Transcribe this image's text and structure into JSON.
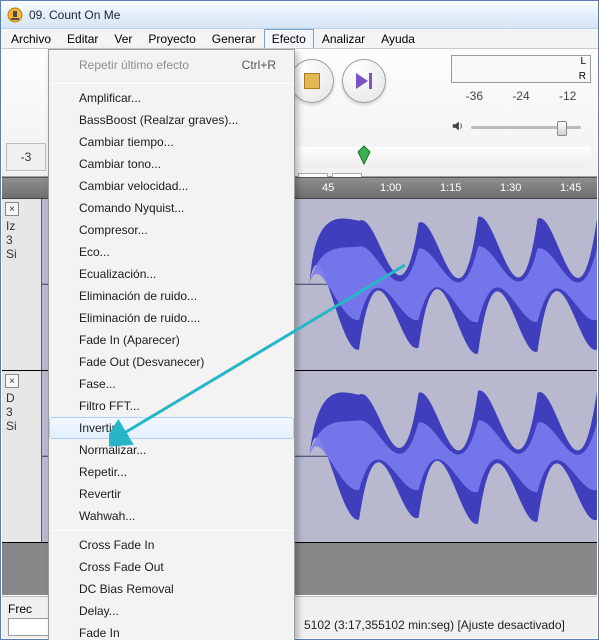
{
  "window": {
    "title": "09. Count On Me"
  },
  "menubar": {
    "items": [
      {
        "label": "Archivo"
      },
      {
        "label": "Editar"
      },
      {
        "label": "Ver"
      },
      {
        "label": "Proyecto"
      },
      {
        "label": "Generar"
      },
      {
        "label": "Efecto"
      },
      {
        "label": "Analizar"
      },
      {
        "label": "Ayuda"
      }
    ],
    "open_index": 5
  },
  "effect_menu": {
    "top": {
      "label": "Repetir último efecto",
      "accel": "Ctrl+R",
      "disabled": true
    },
    "group1": [
      "Amplificar...",
      "BassBoost (Realzar graves)...",
      "Cambiar tiempo...",
      "Cambiar tono...",
      "Cambiar velocidad...",
      "Comando Nyquist...",
      "Compresor...",
      "Eco...",
      "Ecualización...",
      "Eliminación de ruido...",
      "Eliminación de ruido....",
      "Fade In (Aparecer)",
      "Fade Out (Desvanecer)",
      "Fase...",
      "Filtro FFT...",
      "Invertir",
      "Normalizar...",
      "Repetir...",
      "Revertir",
      "Wahwah..."
    ],
    "highlight_index": 15,
    "group2": [
      "Cross Fade In",
      "Cross Fade Out",
      "DC Bias Removal",
      "Delay...",
      "Fade In"
    ]
  },
  "meter": {
    "L": "L",
    "R": "R",
    "ticks": [
      "-36",
      "-24",
      "-12"
    ]
  },
  "timeline": {
    "ticks": [
      "45",
      "1:00",
      "1:15",
      "1:30",
      "1:45"
    ]
  },
  "track_panel": {
    "tracks": [
      {
        "label_lines": [
          "Iz",
          "3",
          "Si"
        ]
      },
      {
        "label_lines": [
          "D",
          "3",
          "Si"
        ]
      }
    ],
    "left_meter": "-3"
  },
  "status": {
    "rate_label": "Frec",
    "selection": "5102 (3:17,355102 min:seg)  [Ajuste desactivado]"
  },
  "icons": {
    "stop": "stop-icon",
    "end": "skip-end-icon",
    "speaker": "speaker-icon",
    "zoom_in": "zoom-in-fit-icon",
    "zoom_sel": "zoom-selection-icon",
    "pin": "playhead-pin-icon"
  }
}
